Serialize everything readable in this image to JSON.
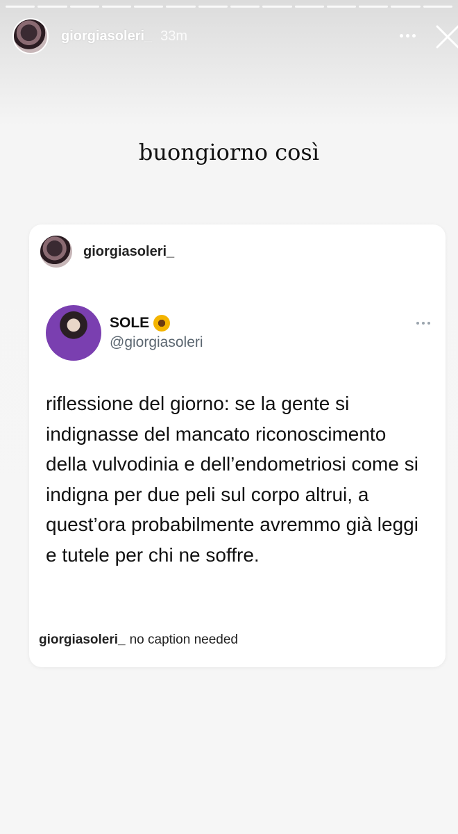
{
  "story": {
    "username": "giorgiasoleri_",
    "time_ago": "33m",
    "segment_count": 14,
    "text": "buongiorno così",
    "icons": {
      "more": "more-horizontal-icon",
      "close": "close-icon"
    }
  },
  "post": {
    "username": "giorgiasoleri_",
    "tweet": {
      "display_name": "SOLE",
      "emoji": "🌻",
      "handle": "@giorgiasoleri",
      "text": "riflessione del giorno: se la gente si indignasse del mancato riconoscimento della vulvodinia e dell’endometriosi come si indigna per due peli sul corpo altrui, a quest’ora probabilmente avremmo già leggi e tutele per chi ne soffre."
    },
    "caption": {
      "username": "giorgiasoleri_",
      "text": "no caption needed"
    }
  }
}
